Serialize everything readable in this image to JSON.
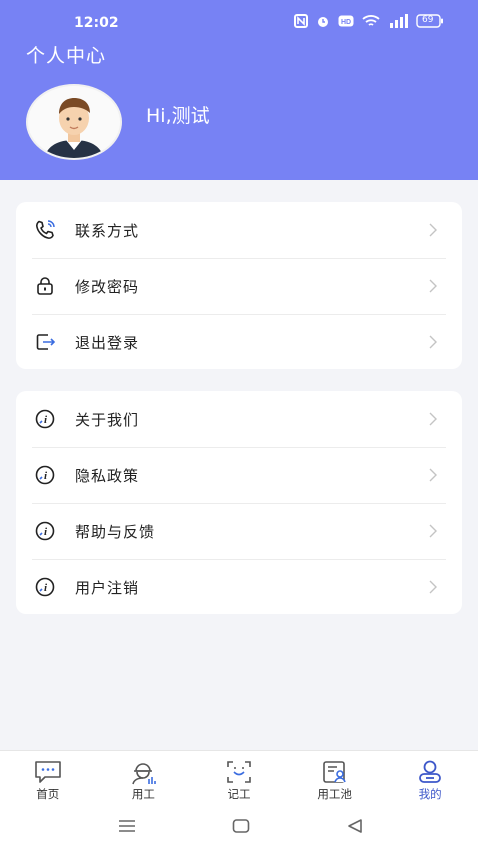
{
  "status_bar": {
    "time": "12:02",
    "battery": "69"
  },
  "header": {
    "title": "个人中心",
    "greeting": "Hi,测试"
  },
  "menu_group_1": [
    {
      "label": "联系方式",
      "icon": "phone-icon"
    },
    {
      "label": "修改密码",
      "icon": "lock-icon"
    },
    {
      "label": "退出登录",
      "icon": "logout-icon"
    }
  ],
  "menu_group_2": [
    {
      "label": "关于我们",
      "icon": "info-icon"
    },
    {
      "label": "隐私政策",
      "icon": "info-icon"
    },
    {
      "label": "帮助与反馈",
      "icon": "info-icon"
    },
    {
      "label": "用户注销",
      "icon": "info-icon"
    }
  ],
  "tabbar": [
    {
      "label": "首页",
      "icon": "message-icon"
    },
    {
      "label": "用工",
      "icon": "worker-icon"
    },
    {
      "label": "记工",
      "icon": "scan-icon"
    },
    {
      "label": "用工池",
      "icon": "pool-icon"
    },
    {
      "label": "我的",
      "icon": "profile-icon",
      "active": true
    }
  ],
  "colors": {
    "header": "#7782f4",
    "active_tab": "#3d57c9",
    "accent": "#3b6de0"
  }
}
